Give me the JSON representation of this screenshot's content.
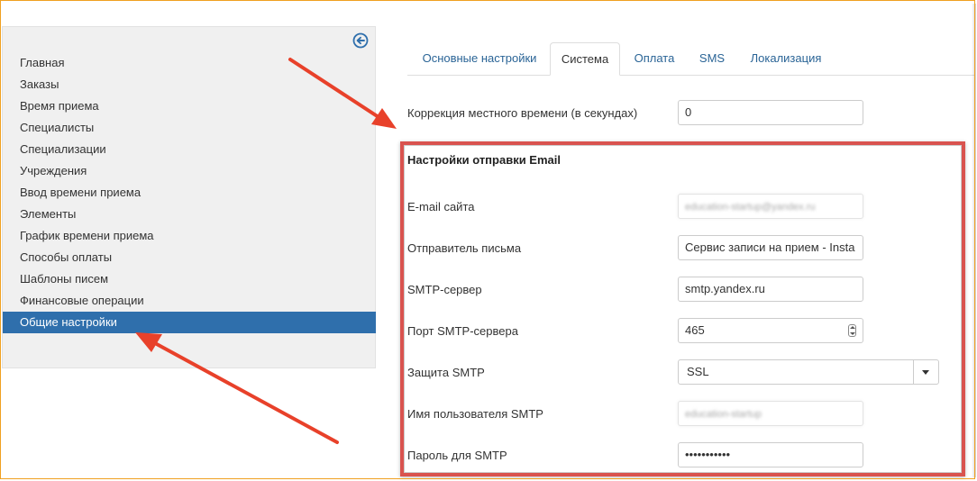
{
  "sidebar": {
    "items": [
      {
        "label": "Главная",
        "active": false
      },
      {
        "label": "Заказы",
        "active": false
      },
      {
        "label": "Время приема",
        "active": false
      },
      {
        "label": "Специалисты",
        "active": false
      },
      {
        "label": "Специализации",
        "active": false
      },
      {
        "label": "Учреждения",
        "active": false
      },
      {
        "label": "Ввод времени приема",
        "active": false
      },
      {
        "label": "Элементы",
        "active": false
      },
      {
        "label": "График времени приема",
        "active": false
      },
      {
        "label": "Способы оплаты",
        "active": false
      },
      {
        "label": "Шаблоны писем",
        "active": false
      },
      {
        "label": "Финансовые операции",
        "active": false
      },
      {
        "label": "Общие настройки",
        "active": true
      }
    ]
  },
  "tabs": [
    {
      "label": "Основные настройки",
      "active": false
    },
    {
      "label": "Система",
      "active": true
    },
    {
      "label": "Оплата",
      "active": false
    },
    {
      "label": "SMS",
      "active": false
    },
    {
      "label": "Локализация",
      "active": false
    }
  ],
  "time_correction": {
    "label": "Коррекция местного времени (в секундах)",
    "value": "0"
  },
  "email_section": {
    "title": "Настройки отправки Email",
    "site_email": {
      "label": "E-mail сайта",
      "value": "education-startup@yandex.ru"
    },
    "sender": {
      "label": "Отправитель письма",
      "value": "Сервис записи на прием - Insta"
    },
    "smtp_server": {
      "label": "SMTP-сервер",
      "value": "smtp.yandex.ru"
    },
    "smtp_port": {
      "label": "Порт SMTP-сервера",
      "value": "465"
    },
    "smtp_security": {
      "label": "Защита SMTP",
      "value": "SSL"
    },
    "smtp_user": {
      "label": "Имя пользователя SMTP",
      "value": "education-startup"
    },
    "smtp_password": {
      "label": "Пароль для SMTP",
      "value": "•••••••••••"
    }
  },
  "colors": {
    "active_nav": "#2f6fac",
    "link": "#2a6496",
    "highlight_box": "#d9534f",
    "annotation_arrow": "#e8412a"
  },
  "icons": {
    "collapse": "circle-arrow-left-icon",
    "select": "caret-down-icon",
    "spinner": "number-spinner-icon"
  }
}
